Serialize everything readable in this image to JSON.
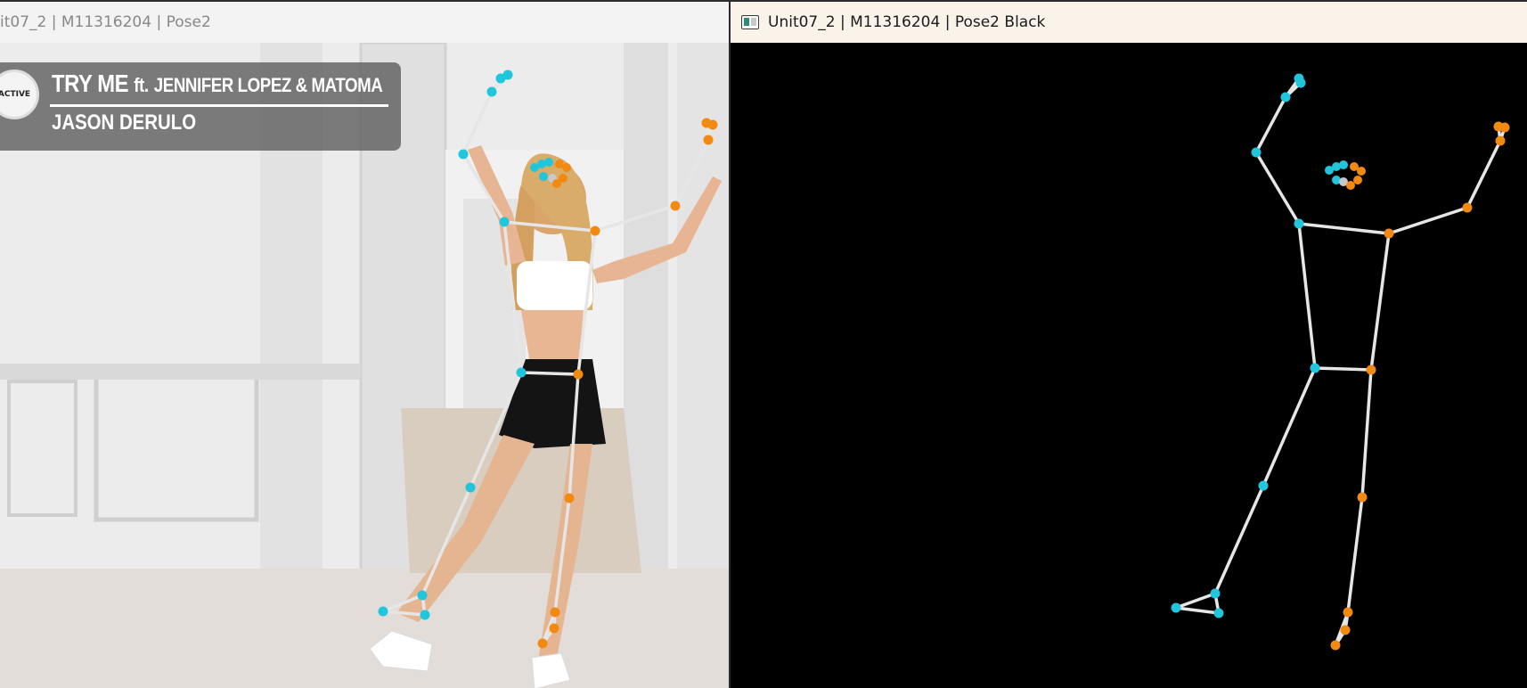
{
  "windows": {
    "left": {
      "title": "it07_2 | M11316204 | Pose2"
    },
    "right": {
      "title": "Unit07_2 | M11316204 | Pose2 Black",
      "icon": "app-window-icon"
    }
  },
  "banner": {
    "logo_text": "ACTIVE",
    "title": "TRY ME",
    "feat": "ft.",
    "featured": "JENNIFER LOPEZ & MATOMA",
    "artist": "JASON DERULO"
  },
  "colors": {
    "left_side": "#1fc6dc",
    "right_side": "#f28a12",
    "bone": "#e6e6e6",
    "face": "#c8c8c8"
  }
}
